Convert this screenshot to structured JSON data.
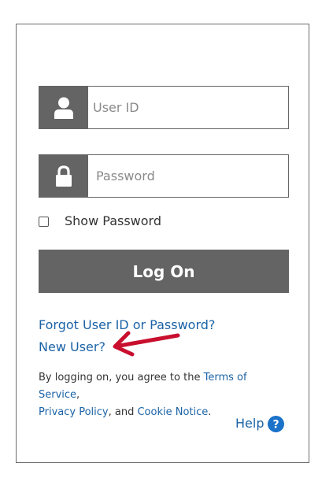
{
  "login": {
    "user_id_placeholder": "User ID",
    "password_placeholder": "Password",
    "show_password_label": "Show Password",
    "logon_label": "Log On",
    "forgot_link": "Forgot User ID or Password?",
    "new_user_link": "New User?",
    "legal": {
      "prefix": "By logging on, you agree to the ",
      "terms_link": "Terms of Service",
      "sep1": ",",
      "privacy_link": "Privacy Policy",
      "sep2": ", and ",
      "cookie_link": "Cookie Notice",
      "suffix": "."
    },
    "help_label": "Help"
  },
  "icons": {
    "user_field_icon": "person-icon",
    "password_field_icon": "lock-icon",
    "help_icon": "question-circle-icon",
    "annotation_arrow": "red-arrow-icon"
  },
  "colors": {
    "icon_block": "#646464",
    "button": "#646464",
    "link": "#1b63a6",
    "help_circle": "#1b72c9",
    "arrow": "#c8102e"
  }
}
